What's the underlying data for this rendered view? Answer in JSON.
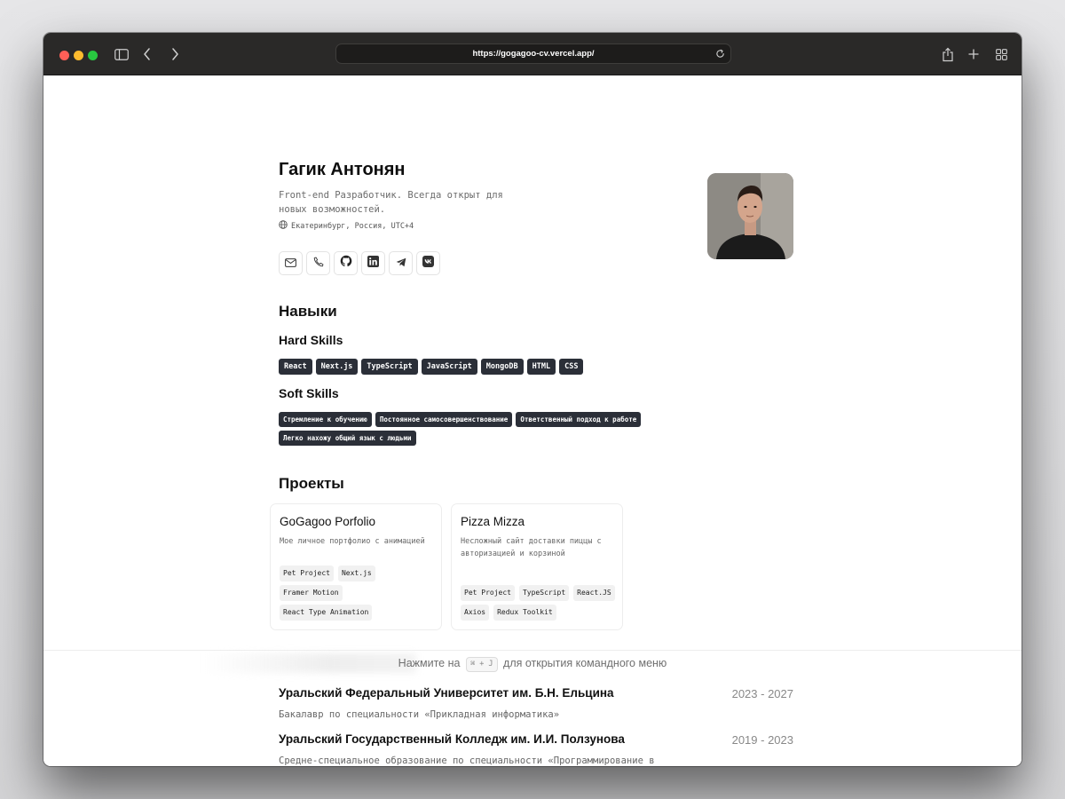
{
  "browser": {
    "url": "https://gogagoo-cv.vercel.app/"
  },
  "profile": {
    "name": "Гагик Антонян",
    "about": "Front-end Разработчик. Всегда открыт для новых возможностей.",
    "location": "Екатеринбург, Россия, UTC+4",
    "contacts": [
      "mail-icon",
      "phone-icon",
      "github-icon",
      "linkedin-icon",
      "telegram-icon",
      "vk-icon"
    ]
  },
  "skills": {
    "heading": "Навыки",
    "hard_heading": "Hard Skills",
    "hard": [
      "React",
      "Next.js",
      "TypeScript",
      "JavaScript",
      "MongoDB",
      "HTML",
      "CSS"
    ],
    "soft_heading": "Soft Skills",
    "soft": [
      "Стремление к обучению",
      "Постоянное самосовершенствование",
      "Ответственный подход к работе",
      "Легко нахожу общий язык с людьми"
    ]
  },
  "projects": {
    "heading": "Проекты",
    "items": [
      {
        "title": "GoGagoo Porfolio",
        "description": "Мое личное портфолио с анимацией",
        "tags": [
          "Pet Project",
          "Next.js",
          "Framer Motion",
          "React Type Animation"
        ]
      },
      {
        "title": "Pizza Mizza",
        "description": "Несложный сайт доставки пиццы с авторизацией и корзиной",
        "tags": [
          "Pet Project",
          "TypeScript",
          "React.JS",
          "Axios",
          "Redux Toolkit"
        ]
      }
    ]
  },
  "command_bar": {
    "before": "Нажмите на",
    "shortcut": "⌘ + J",
    "after": "для открытия командного меню"
  },
  "education": [
    {
      "title": "Уральский Федеральный Университет им. Б.Н. Ельцина",
      "years": "2023 - 2027",
      "description": "Бакалавр по специальности «Прикладная информатика»"
    },
    {
      "title": "Уральский Государственный Колледж им. И.И. Ползунова",
      "years": "2019 - 2023",
      "description": "Средне-специальное образование по специальности «Программирование в компьютерных системах»"
    }
  ],
  "colors": {
    "badge_bg": "#2b2f38",
    "toolbar_bg": "#2a2928",
    "traffic_red": "#ff5f57",
    "traffic_yellow": "#febc2e",
    "traffic_green": "#28c840"
  }
}
